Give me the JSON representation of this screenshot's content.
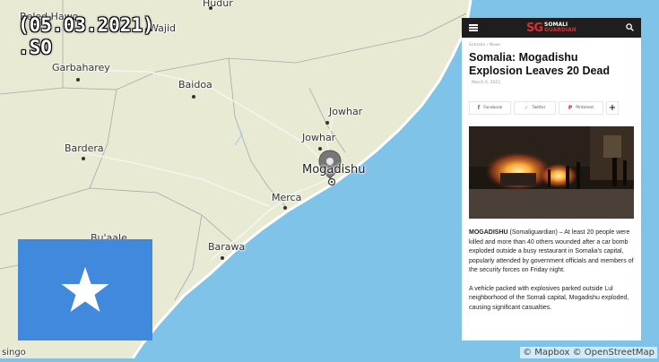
{
  "overlay": {
    "date_line1": "(05.03.2021)",
    "date_line2": ".SO"
  },
  "map": {
    "attribution": "© Mapbox © OpenStreetMap",
    "colors": {
      "land": "#e8ead4",
      "sea": "#7fc3e8",
      "coast": "#ffffff",
      "border": "#a9a9a9"
    },
    "cities": [
      {
        "id": "beled-hawo",
        "name": "Beled Hawo"
      },
      {
        "id": "hudur",
        "name": "Hudur"
      },
      {
        "id": "wajid",
        "name": "Wajid"
      },
      {
        "id": "garbaharey",
        "name": "Garbaharey"
      },
      {
        "id": "baidoa",
        "name": "Baidoa"
      },
      {
        "id": "jowhar-1",
        "name": "Jowhar"
      },
      {
        "id": "jowhar-2",
        "name": "Jowhar"
      },
      {
        "id": "bardera",
        "name": "Bardera"
      },
      {
        "id": "mogadishu",
        "name": "Mogadishu"
      },
      {
        "id": "merca",
        "name": "Merca"
      },
      {
        "id": "buaale",
        "name": "Bu'aale"
      },
      {
        "id": "barawa",
        "name": "Barawa"
      },
      {
        "id": "singo",
        "name": "singo"
      }
    ],
    "marker_icon": "location-pin-icon"
  },
  "flag": {
    "country": "Somalia",
    "background": "#4189dd",
    "star_color": "#ffffff",
    "icon": "star-icon"
  },
  "article": {
    "logo": {
      "mark": "SG",
      "line1": "SOMALI",
      "line2": "GUARDIAN"
    },
    "breadcrumbs": [
      "Somalia",
      "News"
    ],
    "headline": "Somalia: Mogadishu Explosion Leaves 20 Dead",
    "date": "March 6, 2021",
    "share": {
      "facebook": "Facebook",
      "twitter": "Twitter",
      "pinterest": "Pinterest",
      "more": "+"
    },
    "paragraph1": {
      "lead": "MOGADISHU",
      "text": " (Somaliguardian) – At least 20 people were killed and more than 40 others wounded after a car bomb exploded outside a busy restaurant in Somalia's capital, popularly attended by government officials and members of the security forces on Friday night."
    },
    "paragraph2": "A vehicle packed with explosives parked outside Lul neighborhood of the Somali capital, Mogadishu exploded, causing significant casualties."
  }
}
